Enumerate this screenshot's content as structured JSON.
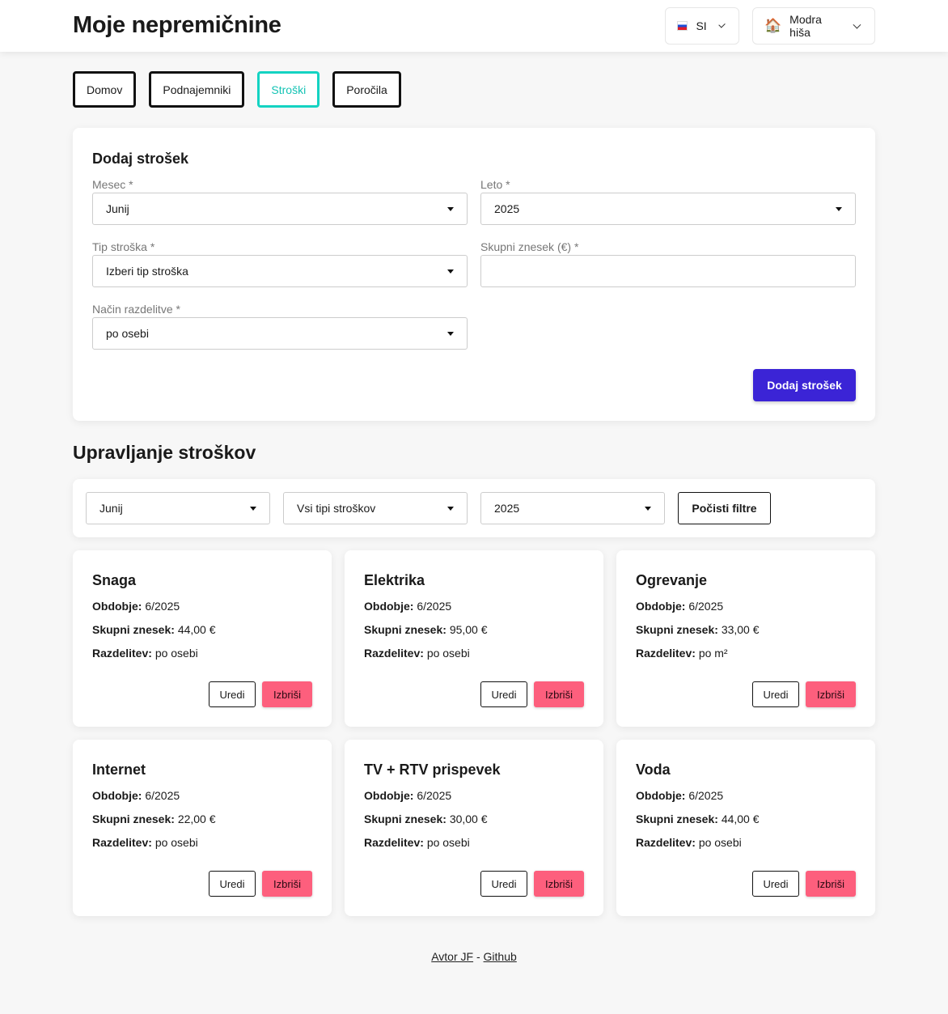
{
  "header": {
    "title": "Moje nepremičnine",
    "language": "SI",
    "language_flag": "slovenia-flag-icon",
    "property": "Modra hiša",
    "property_icon": "house-icon"
  },
  "tabs": [
    {
      "label": "Domov",
      "active": false
    },
    {
      "label": "Podnajemniki",
      "active": false
    },
    {
      "label": "Stroški",
      "active": true
    },
    {
      "label": "Poročila",
      "active": false
    }
  ],
  "form": {
    "title": "Dodaj strošek",
    "month_label": "Mesec *",
    "month_value": "Junij",
    "year_label": "Leto *",
    "year_value": "2025",
    "type_label": "Tip stroška *",
    "type_value": "Izberi tip stroška",
    "amount_label": "Skupni znesek (€) *",
    "amount_value": "",
    "split_label": "Način razdelitve *",
    "split_value": "po osebi",
    "submit": "Dodaj strošek"
  },
  "manage": {
    "title": "Upravljanje stroškov",
    "filter_month": "Junij",
    "filter_type": "Vsi tipi stroškov",
    "filter_year": "2025",
    "clear": "Počisti filtre"
  },
  "labels": {
    "period": "Obdobje:",
    "amount": "Skupni znesek:",
    "split": "Razdelitev:",
    "edit": "Uredi",
    "delete": "Izbriši"
  },
  "expenses": [
    {
      "name": "Snaga",
      "period": "6/2025",
      "amount": "44,00 €",
      "split": "po osebi"
    },
    {
      "name": "Elektrika",
      "period": "6/2025",
      "amount": "95,00 €",
      "split": "po osebi"
    },
    {
      "name": "Ogrevanje",
      "period": "6/2025",
      "amount": "33,00 €",
      "split": "po m²"
    },
    {
      "name": "Internet",
      "period": "6/2025",
      "amount": "22,00 €",
      "split": "po osebi"
    },
    {
      "name": "TV + RTV prispevek",
      "period": "6/2025",
      "amount": "30,00 €",
      "split": "po osebi"
    },
    {
      "name": "Voda",
      "period": "6/2025",
      "amount": "44,00 €",
      "split": "po osebi"
    }
  ],
  "footer": {
    "author": "Avtor JF",
    "sep": "-",
    "github": "Github"
  },
  "colors": {
    "accent": "#14d3c2",
    "primary": "#3b24d6",
    "danger": "#fd5f7d"
  }
}
